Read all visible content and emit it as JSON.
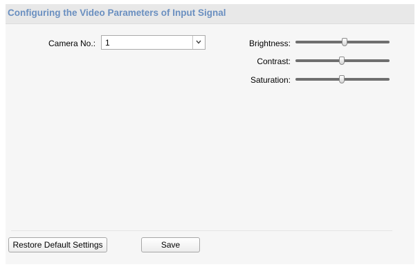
{
  "header": {
    "title": "Configuring the Video Parameters of Input Signal"
  },
  "camera": {
    "label": "Camera No.:",
    "selected": "1",
    "dropdown_icon": "chevron-down-icon"
  },
  "sliders": [
    {
      "label": "Brightness:",
      "value_fraction": 0.52
    },
    {
      "label": "Contrast:",
      "value_fraction": 0.49
    },
    {
      "label": "Saturation:",
      "value_fraction": 0.49
    }
  ],
  "buttons": {
    "restore_label": "Restore Default Settings",
    "save_label": "Save"
  },
  "colors": {
    "title": "#6a8fc0",
    "header_bg": "#e8e8e8",
    "panel_bg": "#f6f6f6",
    "slider_track": "#6f6f6f"
  }
}
